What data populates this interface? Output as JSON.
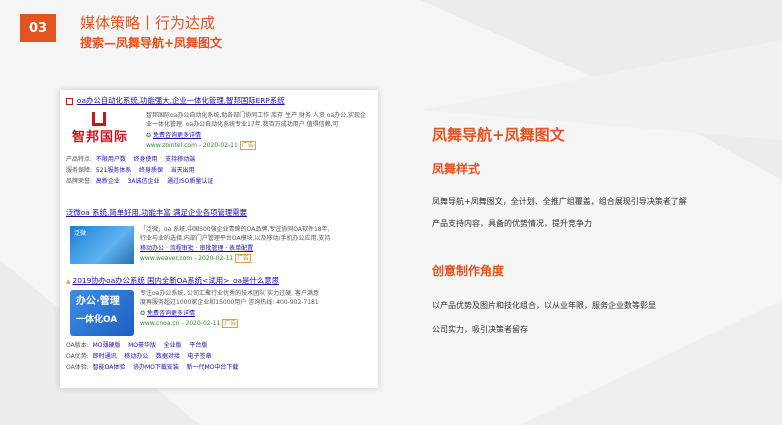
{
  "header": {
    "number": "03",
    "title": "媒体策略丨行为达成",
    "subtitle": "搜索—凤舞导航+凤舞图文"
  },
  "search_results": {
    "result1": {
      "title": "oa办公自动化系统,功能强大,企业一体化管理,智邦国际ERP系统",
      "logo_text": "智邦国际",
      "desc1": "智邦国际oa办公自动化系统,助各部门协同工作 库存 生产 财务 人资 oa办公,实现企",
      "desc2": "业一体化管理. oa办公自动化系统专业17年,数百万成功用户 值得信赖,可",
      "link": "免费咨询更多详情",
      "url": "www.zbintel.com - 2020-02-11",
      "ad": "广告",
      "rows": [
        {
          "k": "产品特点:",
          "v": [
            "不限用户数",
            "终身使用",
            "支持移动端"
          ]
        },
        {
          "k": "服务保障:",
          "v": [
            "521服务体系",
            "终身质保",
            "当天出用"
          ]
        },
        {
          "k": "品牌荣誉:",
          "v": [
            "高新企业",
            "3A诚信企业",
            "通过ISO质量认证"
          ]
        }
      ]
    },
    "result2": {
      "title": "泛微oa 系统,简单好用,功能丰富 满足企业各项管理需要",
      "thumb_text": "泛微",
      "desc1": "「泛微」oa 系统,中国500强企业青睐的OA品牌,专注协同OA软件18年,",
      "desc2": "行业与业的选择,内部门户管理平台OA模块,以及移动/手机办公应用,支持",
      "links": "移动办公 · 流程审批 · 审批管理 · 表单配置",
      "url": "www.weaver.com - 2020-02-11",
      "ad": "广告"
    },
    "result3": {
      "title": "2019协办oa办公系统 国内全新OA系统<试用>_oa是什么意思",
      "thumb_a": "办公·管理",
      "thumb_b": "一体化OA",
      "desc1": "专注oa办公系统, 公司汇聚行业优秀的技术团队 实力过硬, 客户满意",
      "desc2": "度再服务超过1000家企业和15000用户 咨询热线: 400-902-7181",
      "link": "免费咨询更多详情",
      "url": "www.cnoa.cn - 2020-02-11",
      "ad": "广告",
      "rows": [
        {
          "k": "OA版本:",
          "v": [
            "MO薄硬版",
            "MO豪华版",
            "全业版",
            "平台版"
          ]
        },
        {
          "k": "OA优势:",
          "v": [
            "即时通讯",
            "移动办公",
            "数据对接",
            "电子签章"
          ]
        },
        {
          "k": "OA体验:",
          "v": [
            "智能OA体验",
            "协办MO下载安装",
            "新一代MO中台下载"
          ]
        }
      ]
    }
  },
  "right": {
    "title": "凤舞导航+凤舞图文",
    "sub1": "凤舞样式",
    "body1_line1": "凤舞导航+凤舞图文，全计划、全推广组覆盖，组合展现引导决策者了解",
    "body1_line2": "产品支持内容，具备的优势情况，提升竞争力",
    "sub2": "创意制作角度",
    "body2_line1": "以产品优势及图片和技化组合，以从业年限，服务企业数等彰显",
    "body2_line2": "公司实力，吸引决策者留存"
  },
  "colors": {
    "accent": "#e2531f",
    "link": "#1a0dab"
  }
}
